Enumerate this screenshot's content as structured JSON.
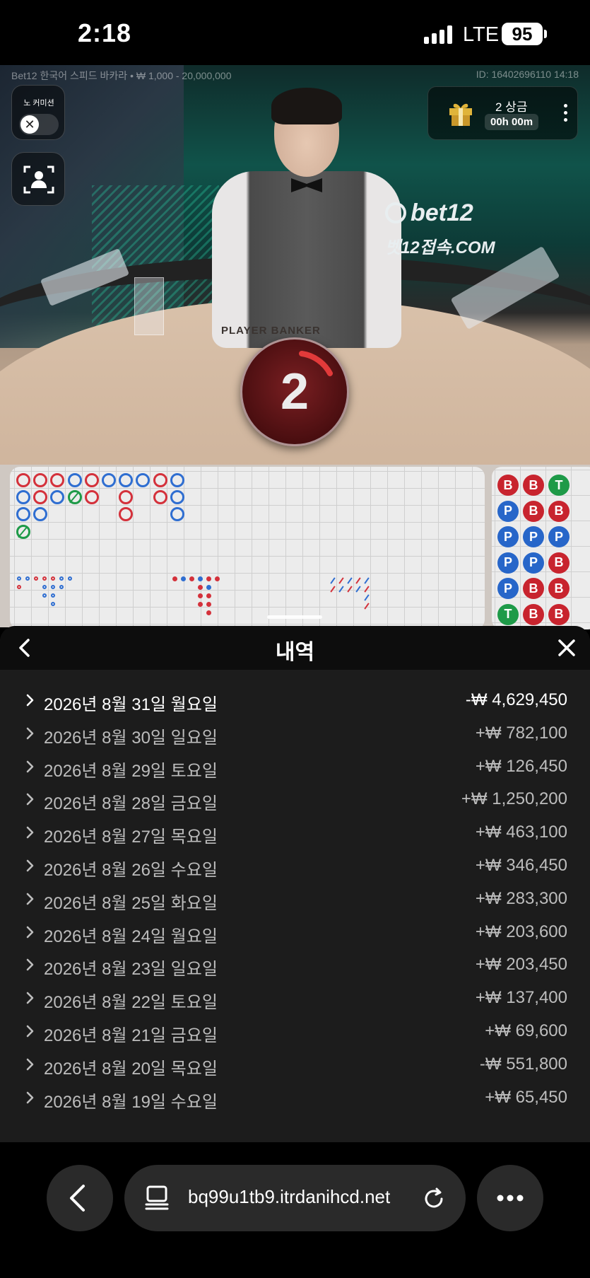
{
  "status_bar": {
    "time": "2:18",
    "network": "LTE",
    "battery": "95"
  },
  "game": {
    "table_info": "Bet12 한국어 스피드 바카라 • ₩ 1,000 - 20,000,000",
    "round_id": "ID: 16402696110 14:18",
    "no_commission_label": "노 커미션",
    "brand_name": "bet12",
    "brand_domain": "벳12접속.COM",
    "table_label": "PLAYER  BANKER",
    "promo_title": "2 상금",
    "promo_timer": "00h 00m",
    "countdown": "2"
  },
  "bead_road": {
    "columns": [
      [
        "B",
        "P",
        "P",
        "T"
      ],
      [
        "B",
        "B",
        "P"
      ],
      [
        "B",
        "P"
      ],
      [
        "P",
        "T"
      ],
      [
        "B",
        "B"
      ],
      [
        "P"
      ],
      [
        "P",
        "B",
        "B"
      ],
      [
        "P"
      ],
      [
        "B",
        "B"
      ],
      [
        "P",
        "P",
        "P"
      ]
    ]
  },
  "big_eye_road": {
    "groups": [
      {
        "cols": [
          [
            "B",
            "R"
          ],
          [
            "B"
          ],
          [
            "R"
          ],
          [
            "R",
            "B",
            "B"
          ],
          [
            "R",
            "B",
            "B",
            "B"
          ],
          [
            "B",
            "B"
          ],
          [
            "B"
          ]
        ]
      },
      {
        "cols": [
          [
            "R"
          ],
          [
            "B"
          ],
          [
            "R"
          ],
          [
            "B",
            "R",
            "R",
            "R"
          ],
          [
            "R",
            "B",
            "R",
            "R",
            "R"
          ],
          [
            "R"
          ]
        ]
      }
    ]
  },
  "small_road": {
    "bead_grid": [
      [
        "B",
        "B",
        "T"
      ],
      [
        "P",
        "B",
        "B"
      ],
      [
        "P",
        "P",
        "P"
      ],
      [
        "P",
        "P",
        "B"
      ],
      [
        "P",
        "B",
        "B"
      ],
      [
        "T",
        "B",
        "B"
      ]
    ]
  },
  "history": {
    "title": "내역",
    "rows": [
      {
        "date": "2026년 8월 31일 월요일",
        "amount": "-₩ 4,629,450"
      },
      {
        "date": "2026년 8월 30일 일요일",
        "amount": "+₩ 782,100"
      },
      {
        "date": "2026년 8월 29일 토요일",
        "amount": "+₩ 126,450"
      },
      {
        "date": "2026년 8월 28일 금요일",
        "amount": "+₩ 1,250,200"
      },
      {
        "date": "2026년 8월 27일 목요일",
        "amount": "+₩ 463,100"
      },
      {
        "date": "2026년 8월 26일 수요일",
        "amount": "+₩ 346,450"
      },
      {
        "date": "2026년 8월 25일 화요일",
        "amount": "+₩ 283,300"
      },
      {
        "date": "2026년 8월 24일 월요일",
        "amount": "+₩ 203,600"
      },
      {
        "date": "2026년 8월 23일 일요일",
        "amount": "+₩ 203,450"
      },
      {
        "date": "2026년 8월 22일 토요일",
        "amount": "+₩ 137,400"
      },
      {
        "date": "2026년 8월 21일 금요일",
        "amount": "+₩ 69,600"
      },
      {
        "date": "2026년 8월 20일 목요일",
        "amount": "-₩ 551,800"
      },
      {
        "date": "2026년 8월 19일 수요일",
        "amount": "+₩ 65,450"
      }
    ]
  },
  "browser": {
    "url": "bq99u1tb9.itrdanihcd.net"
  },
  "colors": {
    "banker": "#d4313b",
    "player": "#2f6ed1",
    "tie": "#1e9a48",
    "sheet_bg": "#1c1c1c"
  }
}
